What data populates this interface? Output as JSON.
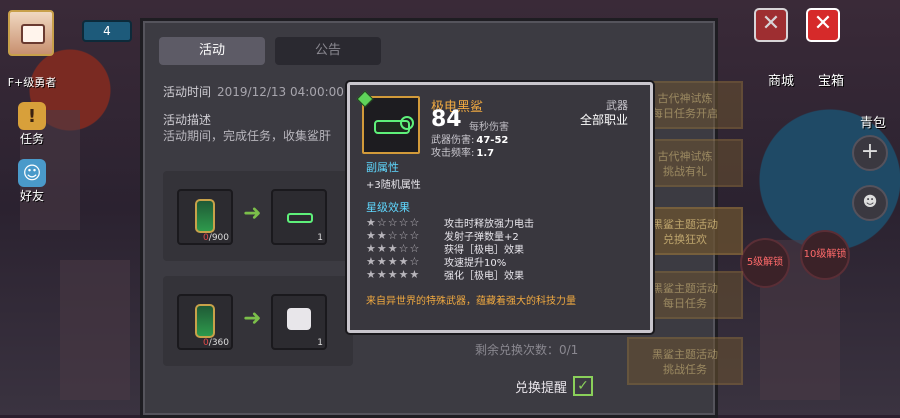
{
  "hud_left": {
    "rank": "F+级勇者",
    "top_badge": "4",
    "task_label": "任务",
    "friend_label": "好友"
  },
  "hud_right": {
    "shop_label": "商城",
    "chest_label": "宝箱",
    "backpack_label": "青包",
    "lock_1": "5级解锁",
    "lock_2": "10级解锁"
  },
  "panel": {
    "tab_activity": "活动",
    "tab_notice": "公告",
    "time_label": "活动时间",
    "time_value": "2019/12/13 04:00:00~",
    "desc_label": "活动描述",
    "desc_text": "活动期间，完成任务，收集鲨肝",
    "rows": [
      {
        "need": "/900",
        "have": "0",
        "reward": "1"
      },
      {
        "need": "/360",
        "have": "0",
        "reward": "1"
      }
    ],
    "remain": "剩余兑换次数：0/1",
    "remind": "兑换提醒",
    "side_buttons": [
      "古代神试炼\n每日任务开启",
      "古代神试炼\n挑战有礼",
      "黑鲨主题活动\n兑换狂欢",
      "黑鲨主题活动\n每日任务",
      "黑鲨主题活动\n挑战任务"
    ]
  },
  "tooltip": {
    "name": "极电黑鲨",
    "dps": "84",
    "dps_label": "每秒伤害",
    "damage_label": "武器伤害:",
    "damage_value": "47-52",
    "freq_label": "攻击频率:",
    "freq_value": "1.7",
    "type": "武器",
    "class": "全部职业",
    "sub_attr_title": "副属性",
    "sub_attr": "+3随机属性",
    "star_title": "星级效果",
    "star_effects": [
      {
        "stars": "★☆☆☆☆",
        "text": "攻击时释放强力电击"
      },
      {
        "stars": "★★☆☆☆",
        "text": "发射子弹数量+2"
      },
      {
        "stars": "★★★☆☆",
        "text": "获得［极电］效果"
      },
      {
        "stars": "★★★★☆",
        "text": "攻速提升10%"
      },
      {
        "stars": "★★★★★",
        "text": "强化［极电］效果"
      }
    ],
    "description": "来自异世界的特殊武器，蕴藏着强大的科技力量"
  },
  "colors": {
    "accent_orange": "#f0a940",
    "section_cyan": "#5fd8ff",
    "close_red": "#d62a2a"
  }
}
